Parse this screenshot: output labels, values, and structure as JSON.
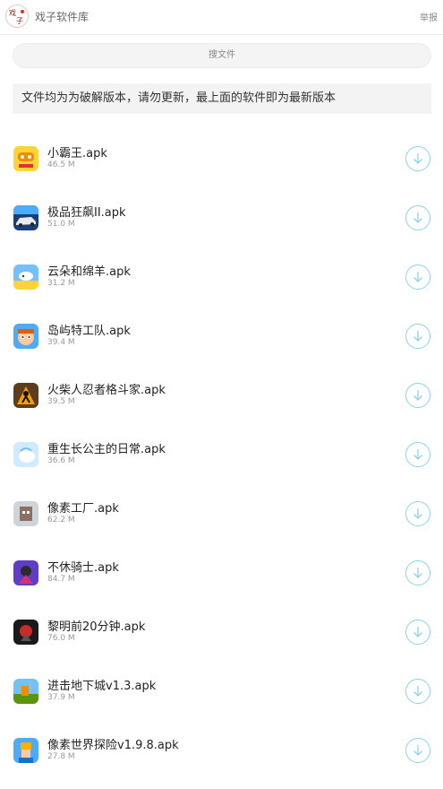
{
  "header": {
    "title": "戏子软件库",
    "report_label": "举报",
    "logo_icon": "xizi-logo-icon"
  },
  "search": {
    "label": "搜文件"
  },
  "notice": {
    "text": "文件均为为破解版本，请勿更新，最上面的软件即为最新版本"
  },
  "colors": {
    "accent": "#8ed3ea",
    "notice_bg": "#f3f3f3"
  },
  "files": [
    {
      "name": "小霸王.apk",
      "size": "46.5 M",
      "icon": "xiaobawang-icon"
    },
    {
      "name": "极品狂飙II.apk",
      "size": "51.0 M",
      "icon": "racing-car-icon"
    },
    {
      "name": "云朵和绵羊.apk",
      "size": "31.2 M",
      "icon": "cloud-sheep-icon"
    },
    {
      "name": "岛屿特工队.apk",
      "size": "39.4 M",
      "icon": "island-squad-icon"
    },
    {
      "name": "火柴人忍者格斗家.apk",
      "size": "39.5 M",
      "icon": "stickman-ninja-icon"
    },
    {
      "name": "重生长公主的日常.apk",
      "size": "36.6 M",
      "icon": "princess-icon"
    },
    {
      "name": "像素工厂.apk",
      "size": "62.2 M",
      "icon": "pixel-factory-icon"
    },
    {
      "name": "不休骑士.apk",
      "size": "84.7 M",
      "icon": "knight-icon"
    },
    {
      "name": "黎明前20分钟.apk",
      "size": "76.0 M",
      "icon": "dawn-20min-icon"
    },
    {
      "name": "进击地下城v1.3.apk",
      "size": "37.9 M",
      "icon": "dungeon-icon"
    },
    {
      "name": "像素世界探险v1.9.8.apk",
      "size": "27.8 M",
      "icon": "pixel-world-icon"
    }
  ]
}
